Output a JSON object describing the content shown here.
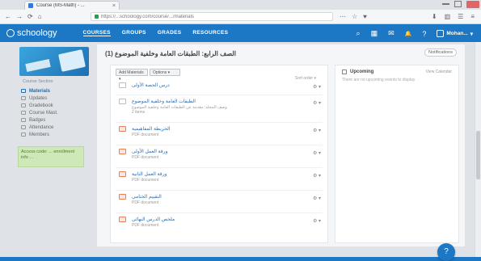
{
  "browser": {
    "tab_title": "Course (MS-Math) - ...",
    "tab_close": "×",
    "url": "https://...schoology.com/course/.../materials",
    "nav": [
      "←",
      "→",
      "⟳",
      "⌂"
    ],
    "ext_icons": [
      "⋯",
      "☆",
      "♥"
    ],
    "right_icons": [
      "⬇",
      "▥",
      "☰",
      "≡"
    ]
  },
  "app": {
    "logo": "schoology",
    "menu": [
      {
        "label": "COURSES",
        "active": true
      },
      {
        "label": "GROUPS",
        "active": false
      },
      {
        "label": "GRADES",
        "active": false
      },
      {
        "label": "RESOURCES",
        "active": false
      }
    ],
    "icons": [
      "⌕",
      "▦",
      "✉",
      "🔔",
      "?"
    ],
    "user_name": "Mohan..."
  },
  "left": {
    "course_name": "Course Section",
    "nav": [
      {
        "label": "Materials",
        "active": true
      },
      {
        "label": "Updates",
        "active": false
      },
      {
        "label": "Gradebook",
        "active": false
      },
      {
        "label": "Course Mast.",
        "active": false
      },
      {
        "label": "Badges",
        "active": false
      },
      {
        "label": "Attendance",
        "active": false
      },
      {
        "label": "Members",
        "active": false
      }
    ],
    "notice": "Access code: ... enrollment info ..."
  },
  "main": {
    "page_title": "الصف الرابع: الطبقات العامة وخلفية الموضوع (1)",
    "options_button": "Notifications",
    "toolbar": [
      "Add Materials ▾",
      "Options ▾"
    ],
    "sort_label": "Sort order ▾",
    "items": [
      {
        "type": "folder",
        "title": "درس الحصة الأولى",
        "sub": "",
        "sub2": ""
      },
      {
        "type": "folder",
        "title": "الطبقات العامة وخلفية الموضوع",
        "sub": "وصف المجلد: مقدمة عن الطبقات العامة وخلفية الموضوع",
        "sub2": "2 items"
      },
      {
        "type": "pdf",
        "title": "الخريطة المفاهيمية",
        "sub": "PDF document",
        "sub2": ""
      },
      {
        "type": "pdf",
        "title": "ورقة العمل الأولى",
        "sub": "PDF document",
        "sub2": ""
      },
      {
        "type": "pdf",
        "title": "ورقة العمل الثانية",
        "sub": "PDF document",
        "sub2": ""
      },
      {
        "type": "pdf",
        "title": "التقييم الختامي",
        "sub": "PDF document",
        "sub2": ""
      },
      {
        "type": "pdf",
        "title": "ملخص الدرس النهائي",
        "sub": "PDF document",
        "sub2": ""
      }
    ],
    "gear": "⚙ ▾"
  },
  "right": {
    "title": "Upcoming",
    "more": "View Calendar",
    "empty_text": "There are no upcoming events to display"
  },
  "fab_label": "?"
}
